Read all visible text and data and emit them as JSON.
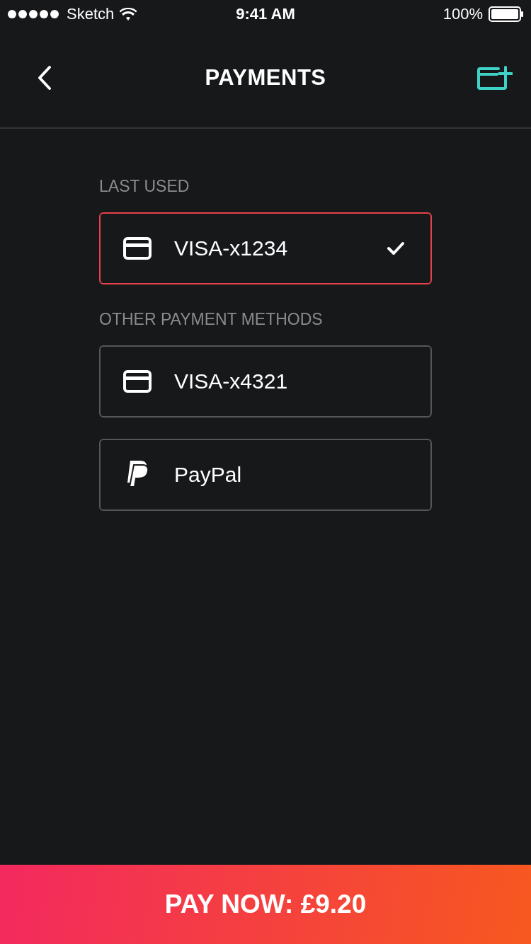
{
  "status_bar": {
    "carrier": "Sketch",
    "time": "9:41 AM",
    "battery": "100%"
  },
  "nav": {
    "title": "PAYMENTS"
  },
  "sections": [
    {
      "label": "LAST USED",
      "methods": [
        {
          "kind": "card",
          "name": "VISA-x1234",
          "selected": true
        }
      ]
    },
    {
      "label": "OTHER PAYMENT METHODS",
      "methods": [
        {
          "kind": "card",
          "name": "VISA-x4321",
          "selected": false
        },
        {
          "kind": "paypal",
          "name": "PayPal",
          "selected": false
        }
      ]
    }
  ],
  "pay_button": "PAY NOW: £9.20"
}
